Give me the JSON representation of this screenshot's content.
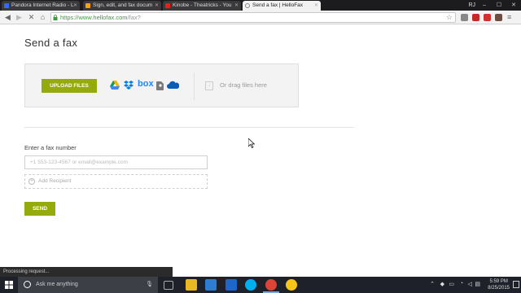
{
  "browser": {
    "tabs": [
      {
        "label": "Pandora Internet Radio - L",
        "color": "#3668ff"
      },
      {
        "label": "Sign, edit, and fax docum",
        "color": "#f7a400"
      },
      {
        "label": "Kinobe - Theatricks - You",
        "color": "#e62117"
      },
      {
        "label": "Send a fax | HelloFax",
        "color": "#888888"
      }
    ],
    "user_badge": "RJ",
    "url": "https://www.hellofax.com",
    "url_path": "/fax?"
  },
  "page": {
    "title": "Send a fax",
    "upload_button": "UPLOAD FILES",
    "services": [
      "google-drive-icon",
      "dropbox-icon",
      "box-icon",
      "evernote-icon",
      "onedrive-icon"
    ],
    "box_label": "box",
    "drag_text": "Or drag files here",
    "fax_label": "Enter a fax number",
    "fax_placeholder": "+1 553-123-4567 or email@example.com",
    "add_recipient": "Add Recipient",
    "send_button": "SEND"
  },
  "status_bar": "Processing request...",
  "taskbar": {
    "search_placeholder": "Ask me anything",
    "time": "5:59 PM",
    "date": "8/25/2015"
  },
  "colors": {
    "accent": "#95aa0d"
  }
}
